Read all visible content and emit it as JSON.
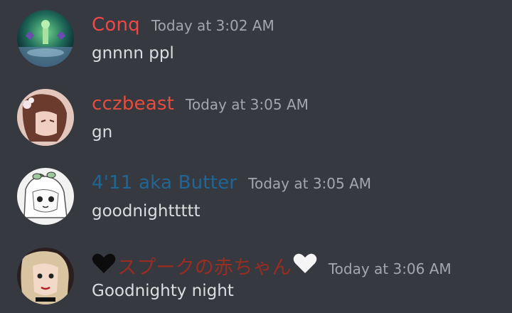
{
  "messages": [
    {
      "username": "Conq",
      "username_color": "#f04747",
      "timestamp": "Today at 3:02 AM",
      "content": "gnnnn ppl"
    },
    {
      "username": "cczbeast",
      "username_color": "#e74c3c",
      "timestamp": "Today at 3:05 AM",
      "content": "gn"
    },
    {
      "username": "4'11 aka Butter",
      "username_color": "#206694",
      "timestamp": "Today at 3:05 AM",
      "content": "goodnighttttt"
    },
    {
      "username": "スプークの赤ちゃん",
      "username_color": "#992d22",
      "username_prefix_icon": "black-heart-icon",
      "username_suffix_icon": "white-heart-icon",
      "timestamp": "Today at 3:06 AM",
      "content": "Goodnighty night"
    }
  ],
  "colors": {
    "background": "#36393f",
    "text": "#dcddde",
    "timestamp": "#a3a6aa"
  }
}
